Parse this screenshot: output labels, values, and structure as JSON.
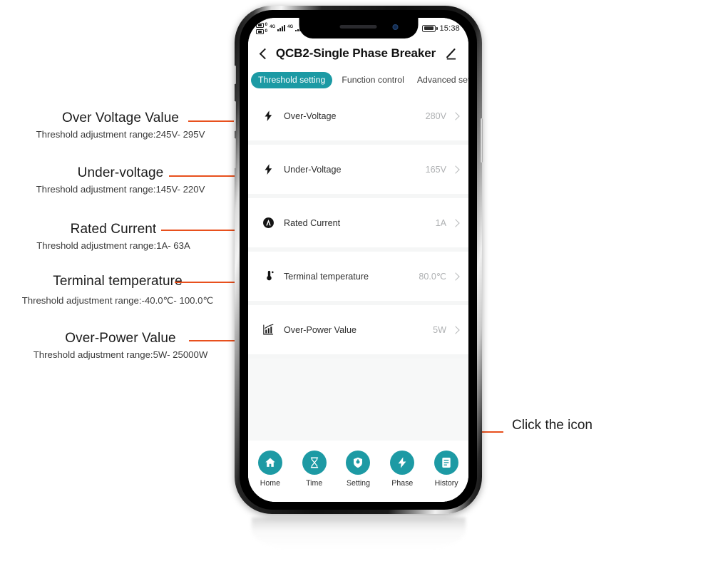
{
  "phone": {
    "status_bar": {
      "sim1_label": "0",
      "sim2_label": "0",
      "network1": "4G",
      "network2": "4G",
      "clock": "15:38",
      "battery_icon": "battery-icon"
    },
    "header": {
      "back_icon": "back-chevron-icon",
      "title": "QCB2-Single Phase Breaker",
      "edit_icon": "pencil-edit-icon"
    },
    "tabs": [
      {
        "label": "Threshold setting",
        "active": true
      },
      {
        "label": "Function control",
        "active": false
      },
      {
        "label": "Advanced setting",
        "active": false
      }
    ],
    "settings_rows": [
      {
        "icon": "bolt-icon",
        "label": "Over-Voltage",
        "value": "280V",
        "chevron": "chevron-right-icon"
      },
      {
        "icon": "bolt-icon",
        "label": "Under-Voltage",
        "value": "165V",
        "chevron": "chevron-right-icon"
      },
      {
        "icon": "ampere-icon",
        "label": "Rated Current",
        "value": "1A",
        "chevron": "chevron-right-icon"
      },
      {
        "icon": "thermometer-icon",
        "label": "Terminal temperature",
        "value": "80.0℃",
        "chevron": "chevron-right-icon"
      },
      {
        "icon": "bar-chart-icon",
        "label": "Over-Power Value",
        "value": "5W",
        "chevron": "chevron-right-icon"
      }
    ],
    "bottom_nav": [
      {
        "icon": "home-icon",
        "label": "Home"
      },
      {
        "icon": "hourglass-icon",
        "label": "Time"
      },
      {
        "icon": "shield-gear-icon",
        "label": "Setting",
        "marked": true
      },
      {
        "icon": "bolt-icon",
        "label": "Phase"
      },
      {
        "icon": "document-icon",
        "label": "History"
      }
    ]
  },
  "annotations": {
    "left": [
      {
        "title": "Over Voltage Value",
        "subtitle": "Threshold adjustment range:245V- 295V"
      },
      {
        "title": "Under-voltage",
        "subtitle": "Threshold adjustment range:145V- 220V"
      },
      {
        "title": "Rated Current",
        "subtitle": "Threshold adjustment range:1A- 63A"
      },
      {
        "title": "Terminal temperature",
        "subtitle": "Threshold adjustment range:-40.0℃- 100.0℃"
      },
      {
        "title": "Over-Power Value",
        "subtitle": "Threshold adjustment range:5W- 25000W"
      }
    ],
    "right": {
      "label": "Click the icon"
    }
  },
  "colors": {
    "accent_teal": "#1d9aa4",
    "callout_orange": "#e8501d",
    "dot_orange": "#f04e17",
    "value_gray": "#aeb0b2",
    "screen_bg": "#f7f8f8"
  }
}
